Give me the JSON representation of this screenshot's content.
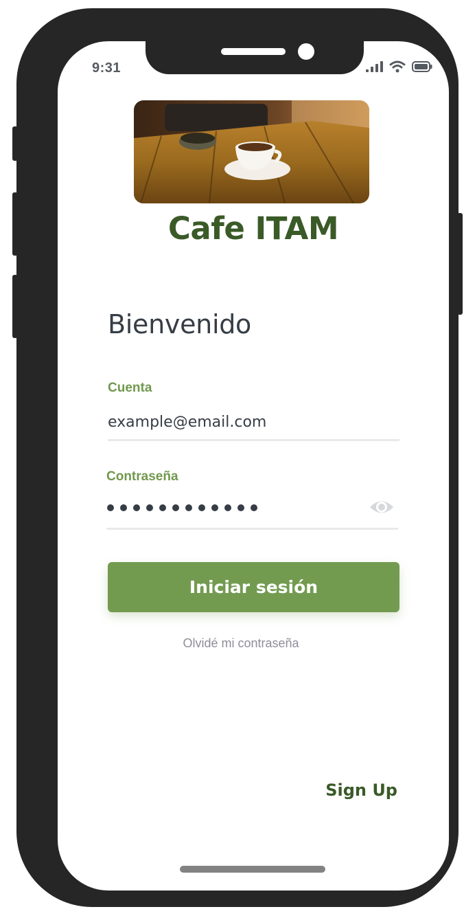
{
  "status_bar": {
    "time": "9:31",
    "icons": [
      "signal-icon",
      "wifi-icon",
      "battery-icon"
    ]
  },
  "hero_image": {
    "subject": "coffee-table-photo"
  },
  "brand": {
    "name": "Cafe ITAM"
  },
  "login": {
    "heading": "Bienvenido",
    "account": {
      "label": "Cuenta",
      "value": "example@email.com"
    },
    "password": {
      "label": "Contraseña",
      "masked_length": 12,
      "toggle_icon": "eye-icon"
    },
    "submit_label": "Iniciar sesión",
    "forgot_label": "Olvidé mi contraseña",
    "signup_label": "Sign Up"
  },
  "colors": {
    "accent_green": "#739b50",
    "brand_dark_green": "#3a5a28",
    "text_dark": "#363d45",
    "muted_text": "#8e8e99",
    "phone_frame": "#262626"
  }
}
